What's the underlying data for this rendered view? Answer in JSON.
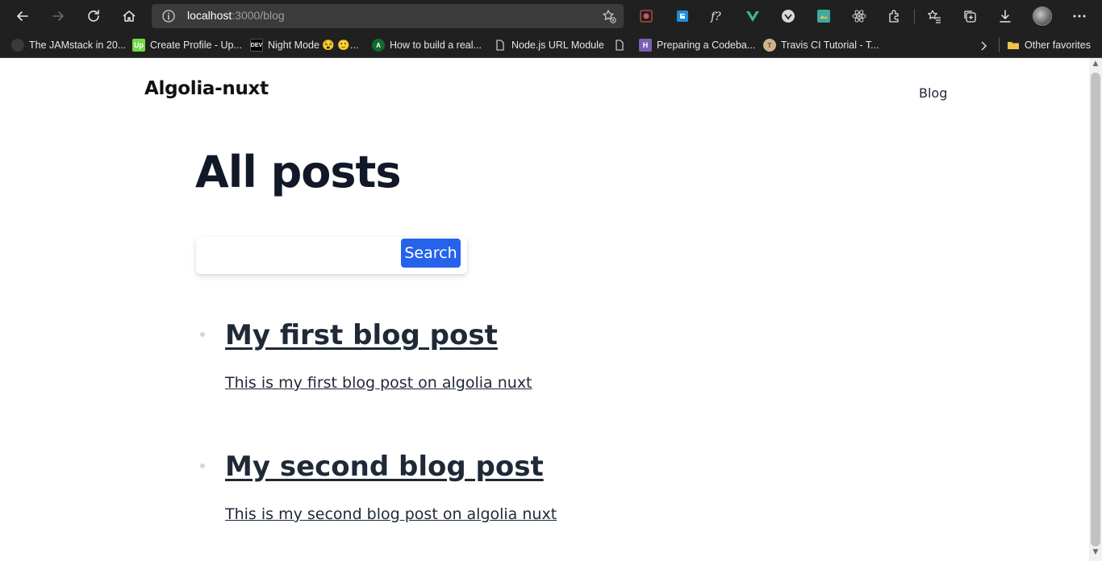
{
  "browser": {
    "url_host": "localhost",
    "url_path": ":3000/blog",
    "bookmarks": [
      {
        "label": "The JAMstack in 20...",
        "icon": "jamstack-icon"
      },
      {
        "label": "Create Profile - Up...",
        "icon": "upwork-icon"
      },
      {
        "label": "Night Mode 😵 🙂...",
        "icon": "dev-icon"
      },
      {
        "label": "How to build a real...",
        "icon": "android-icon"
      },
      {
        "label": "Node.js URL Module",
        "icon": "page-icon"
      },
      {
        "label": "",
        "icon": "page-icon"
      },
      {
        "label": "Preparing a Codeba...",
        "icon": "heroku-icon"
      },
      {
        "label": "Travis CI Tutorial - T...",
        "icon": "travis-icon"
      }
    ],
    "other_favorites": "Other favorites"
  },
  "site": {
    "logo": "Algolia-nuxt",
    "nav_blog": "Blog"
  },
  "page": {
    "title": "All posts",
    "search_input_value": "",
    "search_button": "Search",
    "posts": [
      {
        "title": "My first blog post",
        "description": "This is my first blog post on algolia nuxt"
      },
      {
        "title": "My second blog post",
        "description": "This is my second blog post on algolia nuxt"
      }
    ]
  },
  "colors": {
    "accent": "#2563eb",
    "heading": "#111827",
    "text": "#1f2937",
    "chrome": "#202020"
  }
}
